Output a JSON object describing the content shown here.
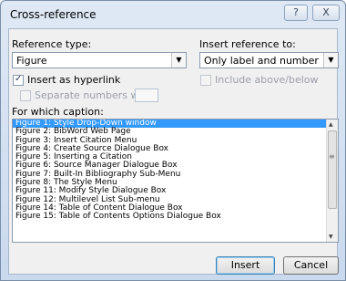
{
  "window": {
    "title": "Cross-reference",
    "help": "?",
    "close": "X"
  },
  "reference_type": {
    "label": "Reference type:",
    "value": "Figure"
  },
  "insert_reference_to": {
    "label": "Insert reference to:",
    "value": "Only label and number"
  },
  "insert_as_hyperlink": {
    "label": "Insert as hyperlink",
    "checked": true
  },
  "include_above_below": {
    "label": "Include above/below",
    "checked": false,
    "disabled": true
  },
  "separate_numbers": {
    "label": "Separate numbers with",
    "checked": false,
    "disabled": true,
    "value": ""
  },
  "caption_list": {
    "label": "For which caption:",
    "items": [
      "Figure 1: Style Drop-Down window",
      "Figure 2: BibWord Web Page",
      "Figure 3: Insert Citation Menu",
      "Figure 4: Create Source Dialogue Box",
      "Figure 5: Inserting a Citation",
      "Figure 6: Source Manager Dialogue Box",
      "Figure 7: Built-In Bibliography Sub-Menu",
      "Figure 8: The Style Menu",
      "Figure 11: Modify Style Dialogue Box",
      "Figure 12: Multilevel List Sub-menu",
      "Figure 14: Table of Content Dialogue Box",
      "Figure 15: Table of Contents Options Dialogue Box"
    ],
    "selected_index": 0
  },
  "buttons": {
    "insert": "Insert",
    "cancel": "Cancel"
  }
}
